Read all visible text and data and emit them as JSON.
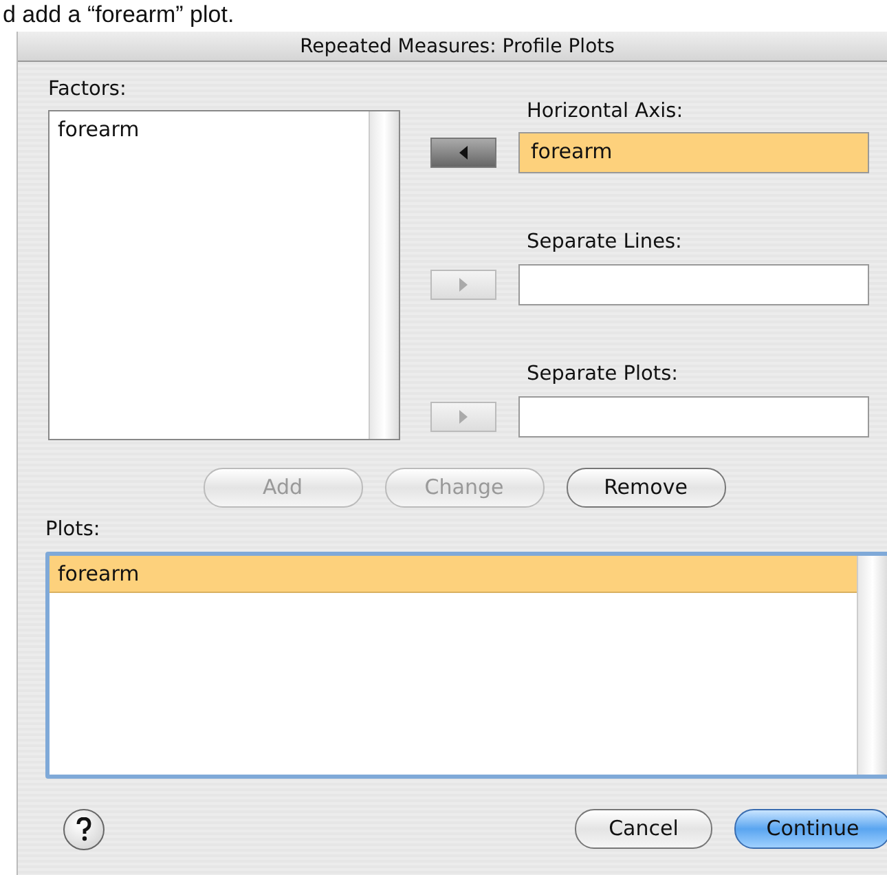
{
  "caption": "d add a “forearm” plot.",
  "window": {
    "title": "Repeated Measures: Profile Plots"
  },
  "factors": {
    "label": "Factors:",
    "items": [
      {
        "text": "forearm",
        "selected": false
      }
    ]
  },
  "targets": [
    {
      "label": "Horizontal Axis:",
      "value": "forearm",
      "selected": true,
      "arrow_points_left": true,
      "arrow_disabled": false
    },
    {
      "label": "Separate Lines:",
      "selected": false,
      "arrow_points_left": false,
      "arrow_disabled": true
    },
    {
      "label": "Separate Plots:",
      "selected": false,
      "arrow_points_left": false,
      "arrow_disabled": true
    }
  ],
  "plot_buttons": [
    {
      "label": "Add",
      "disabled": true
    },
    {
      "label": "Change",
      "disabled": true
    },
    {
      "label": "Remove",
      "disabled": false
    }
  ],
  "plots": {
    "label": "Plots:",
    "items": [
      {
        "text": "forearm",
        "selected": true
      }
    ]
  },
  "footer_buttons": [
    {
      "label": "Cancel",
      "kind": "normal"
    },
    {
      "label": "Continue",
      "kind": "default"
    }
  ]
}
